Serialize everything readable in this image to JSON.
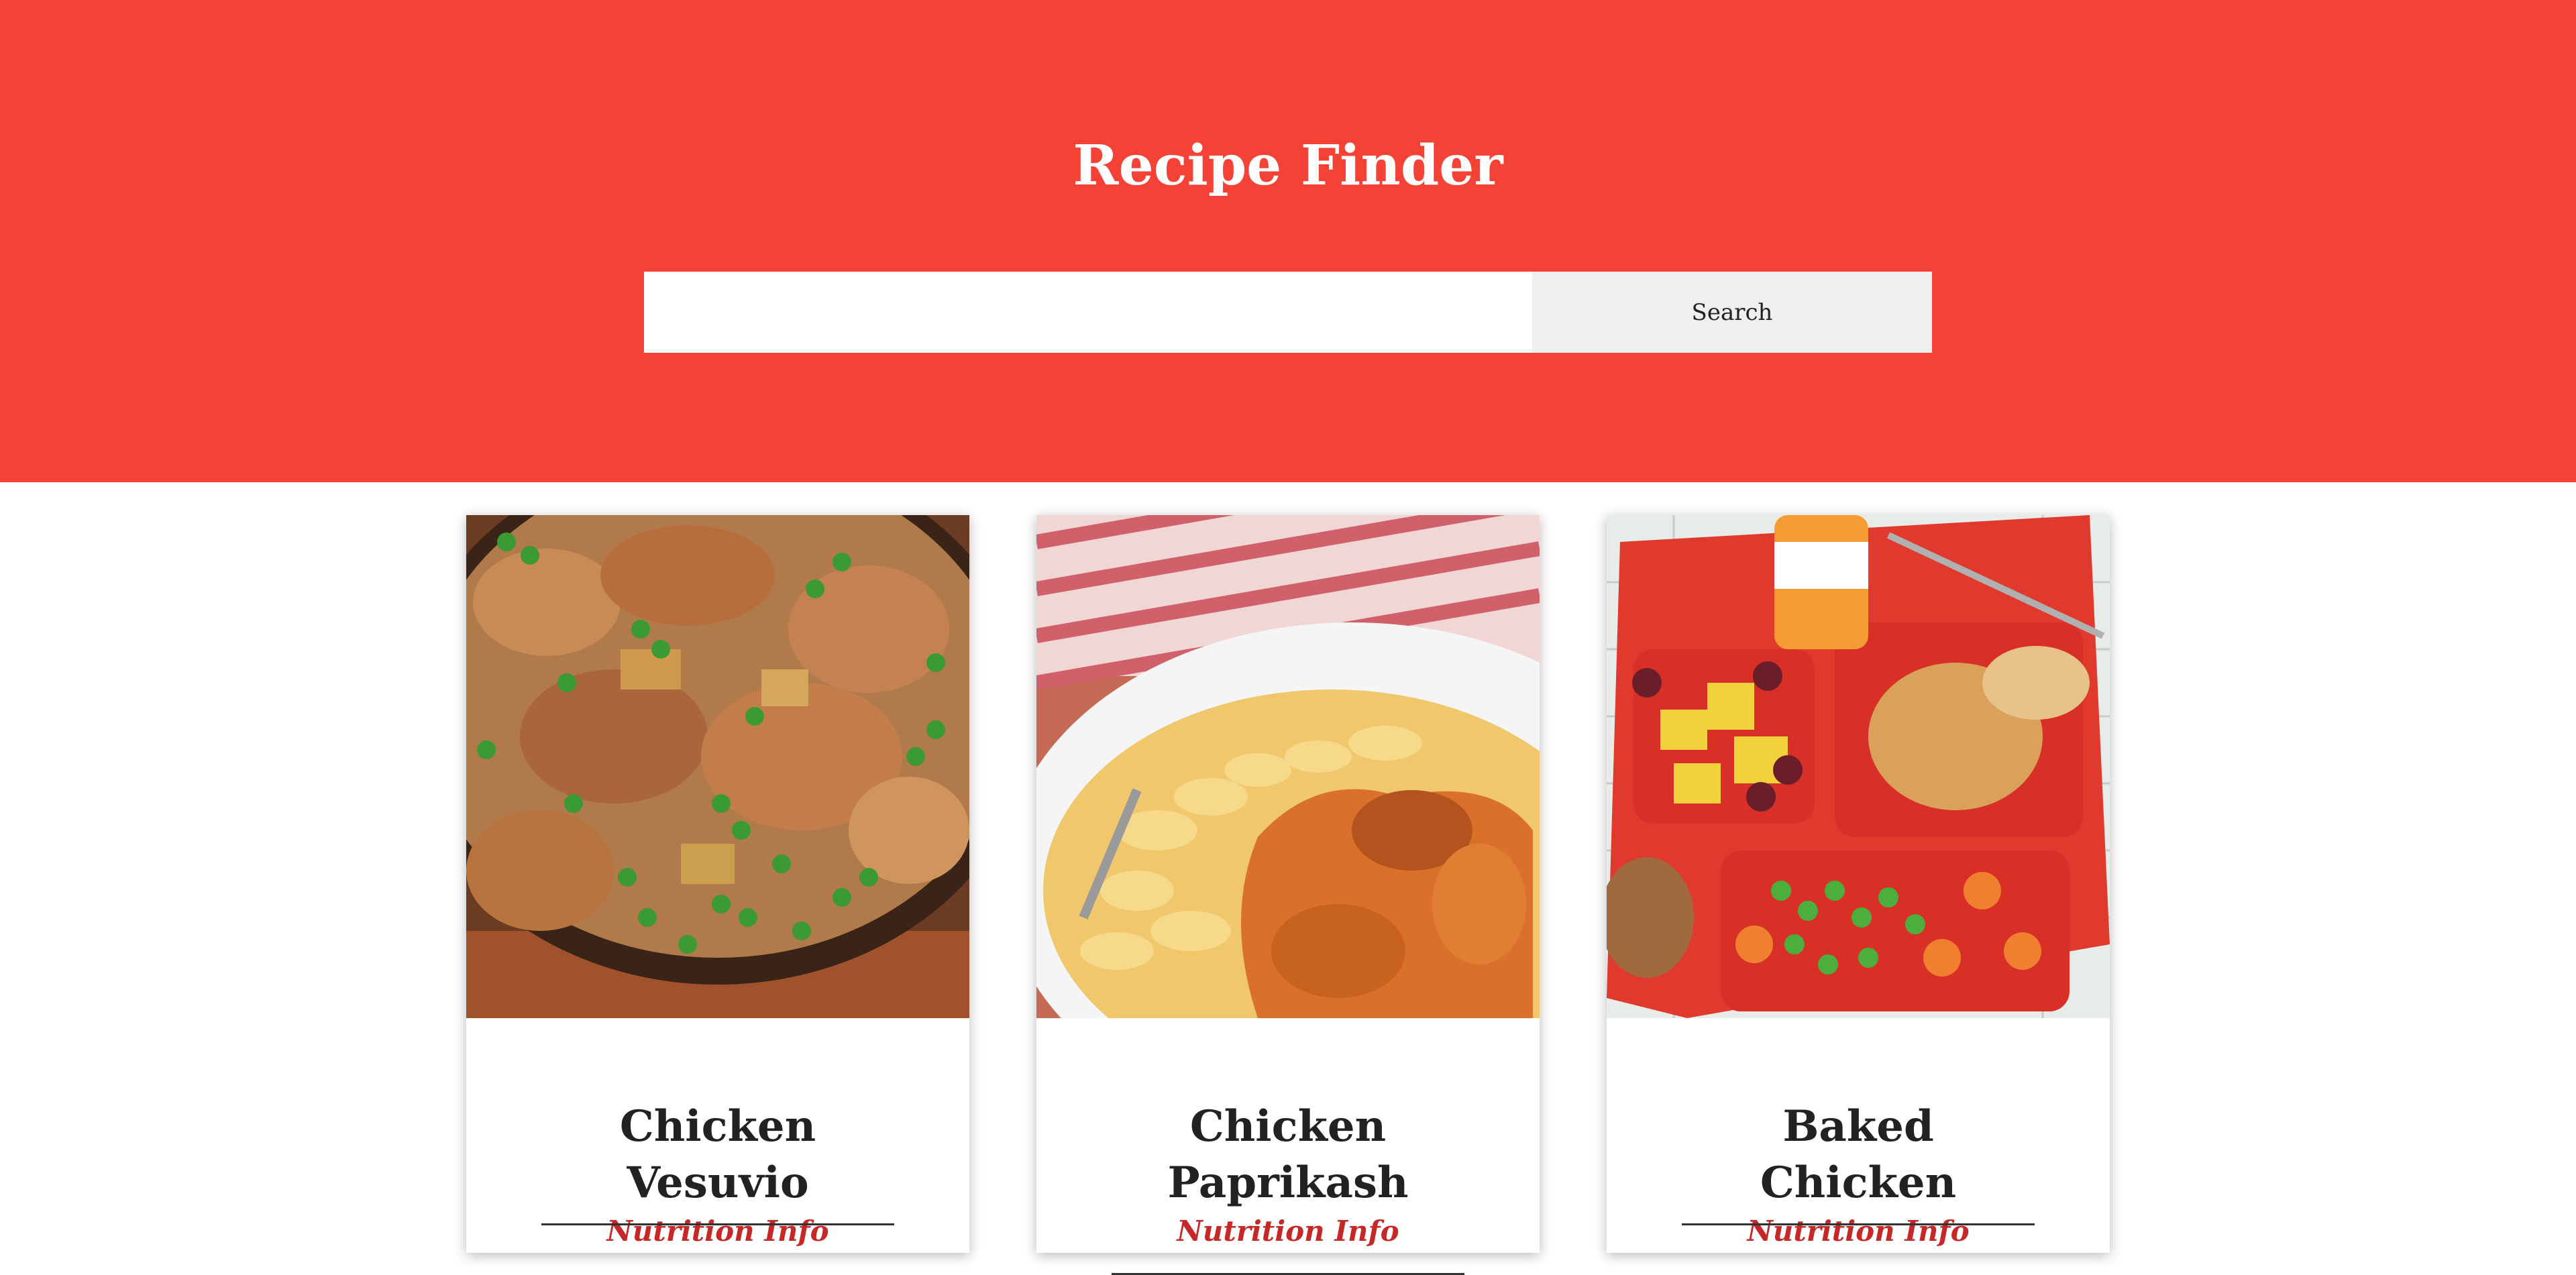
{
  "header": {
    "title": "Recipe Finder",
    "background_color": "#f44336"
  },
  "search": {
    "placeholder": "",
    "value": "",
    "button_label": "Search"
  },
  "recipes": [
    {
      "title": "Chicken Vesuvio",
      "link_label": "Nutrition Info",
      "image_icon": "chicken-vesuvio-photo"
    },
    {
      "title": "Chicken Paprikash",
      "link_label": "Nutrition Info",
      "image_icon": "chicken-paprikash-photo"
    },
    {
      "title": "Baked Chicken",
      "link_label": "Nutrition Info",
      "image_icon": "baked-chicken-photo"
    }
  ],
  "colors": {
    "accent": "#f44336",
    "link": "#c62828",
    "button": "#efefef"
  }
}
